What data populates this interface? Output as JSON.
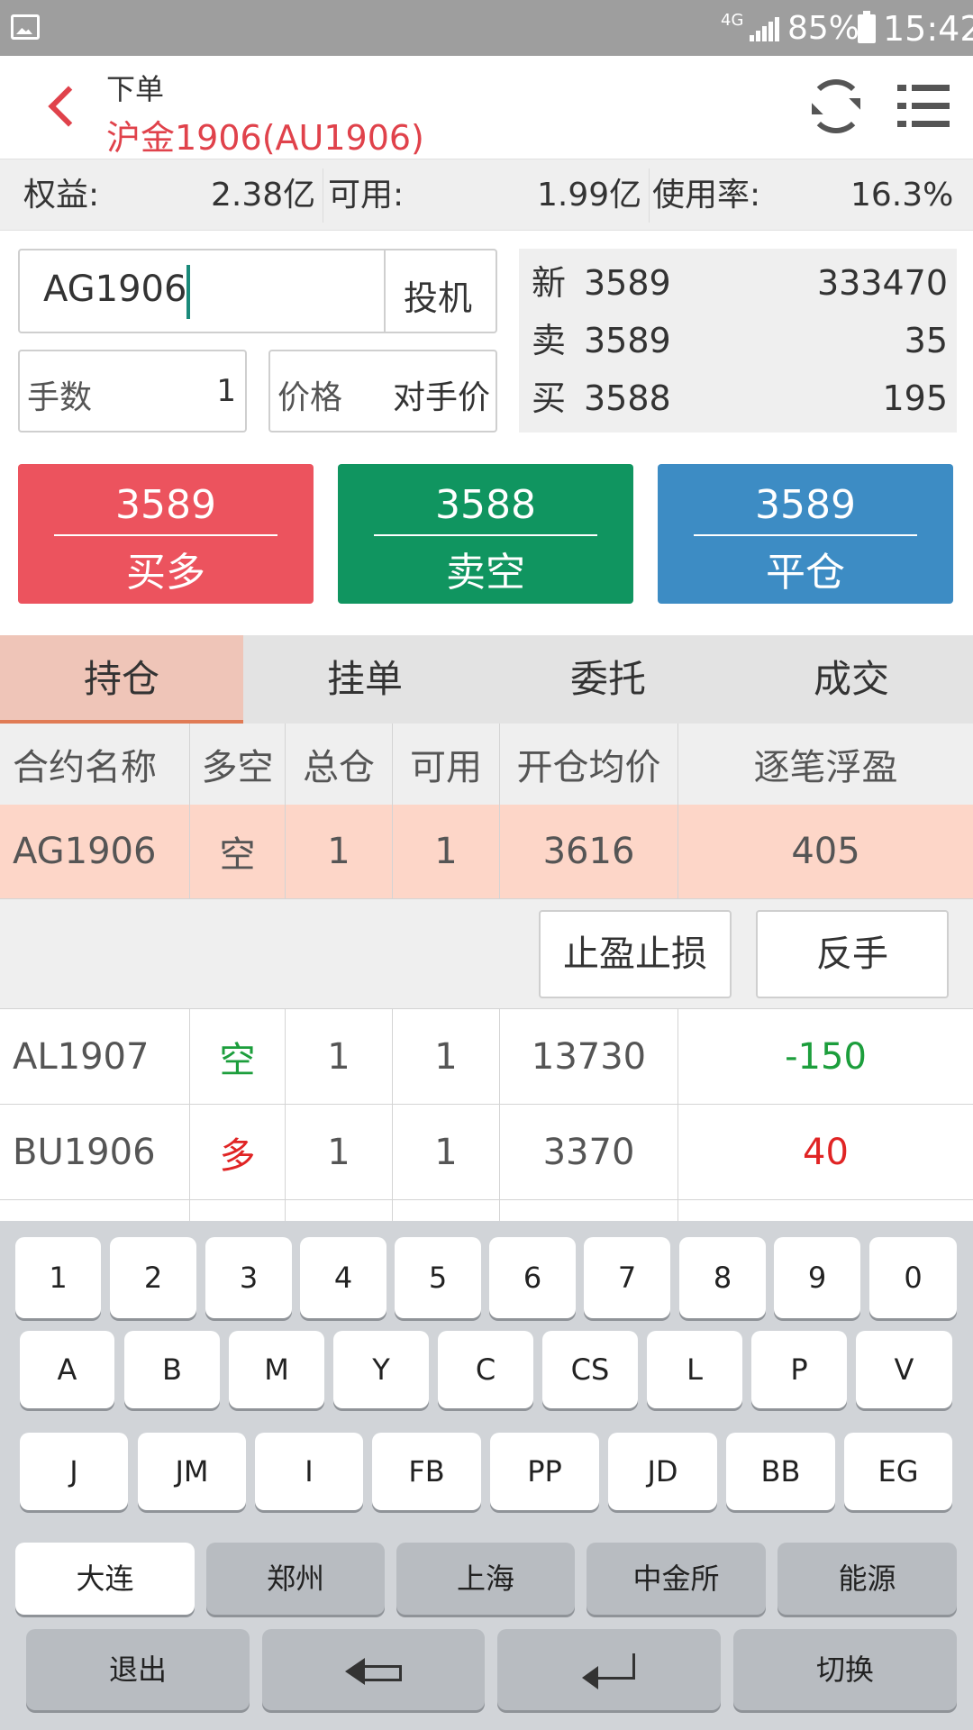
{
  "status_bar": {
    "network": "4G",
    "battery_percent": "85%",
    "time": "15:42"
  },
  "header": {
    "subtitle": "下单",
    "title": "沪金1906(AU1906)",
    "back_icon": "chevron-left-icon",
    "refresh_icon": "refresh-icon",
    "menu_icon": "list-menu-icon",
    "accent_color": "#e0424b"
  },
  "account": {
    "equity_label": "权益:",
    "equity_value": "2.38亿",
    "available_label": "可用:",
    "available_value": "1.99亿",
    "usage_label": "使用率:",
    "usage_value": "16.3%"
  },
  "order": {
    "contract_code": "AG1906",
    "speculation_type": "投机",
    "qty_label": "手数",
    "qty_value": "1",
    "price_label": "价格",
    "price_value": "对手价"
  },
  "quote": {
    "rows": [
      {
        "label": "新",
        "price": "3589",
        "volume": "333470"
      },
      {
        "label": "卖",
        "price": "3589",
        "volume": "35"
      },
      {
        "label": "买",
        "price": "3588",
        "volume": "195"
      }
    ]
  },
  "actions": {
    "buy": {
      "price": "3589",
      "label": "买多",
      "color": "#ec535e"
    },
    "sell": {
      "price": "3588",
      "label": "卖空",
      "color": "#109560"
    },
    "close": {
      "price": "3589",
      "label": "平仓",
      "color": "#3d8cc4"
    }
  },
  "tabs": [
    "持仓",
    "挂单",
    "委托",
    "成交"
  ],
  "table": {
    "headers": [
      "合约名称",
      "多空",
      "总仓",
      "可用",
      "开仓均价",
      "逐笔浮盈"
    ],
    "rows": [
      {
        "contract": "AG1906",
        "direction": "空",
        "total": "1",
        "available": "1",
        "avg_price": "3616",
        "pnl": "405"
      },
      {
        "contract": "AL1907",
        "direction": "空",
        "total": "1",
        "available": "1",
        "avg_price": "13730",
        "pnl": "-150"
      },
      {
        "contract": "BU1906",
        "direction": "多",
        "total": "1",
        "available": "1",
        "avg_price": "3370",
        "pnl": "40"
      }
    ],
    "row_actions": {
      "stop": "止盈止损",
      "reverse": "反手"
    }
  },
  "keyboard": {
    "numbers": [
      "1",
      "2",
      "3",
      "4",
      "5",
      "6",
      "7",
      "8",
      "9",
      "0"
    ],
    "row1": [
      "A",
      "B",
      "M",
      "Y",
      "C",
      "CS",
      "L",
      "P",
      "V"
    ],
    "row2": [
      "J",
      "JM",
      "I",
      "FB",
      "PP",
      "JD",
      "BB",
      "EG"
    ],
    "exchanges": [
      "大连",
      "郑州",
      "上海",
      "中金所",
      "能源"
    ],
    "exit": "退出",
    "switch": "切换",
    "backspace_icon": "backspace-arrow-icon",
    "enter_icon": "enter-icon"
  }
}
